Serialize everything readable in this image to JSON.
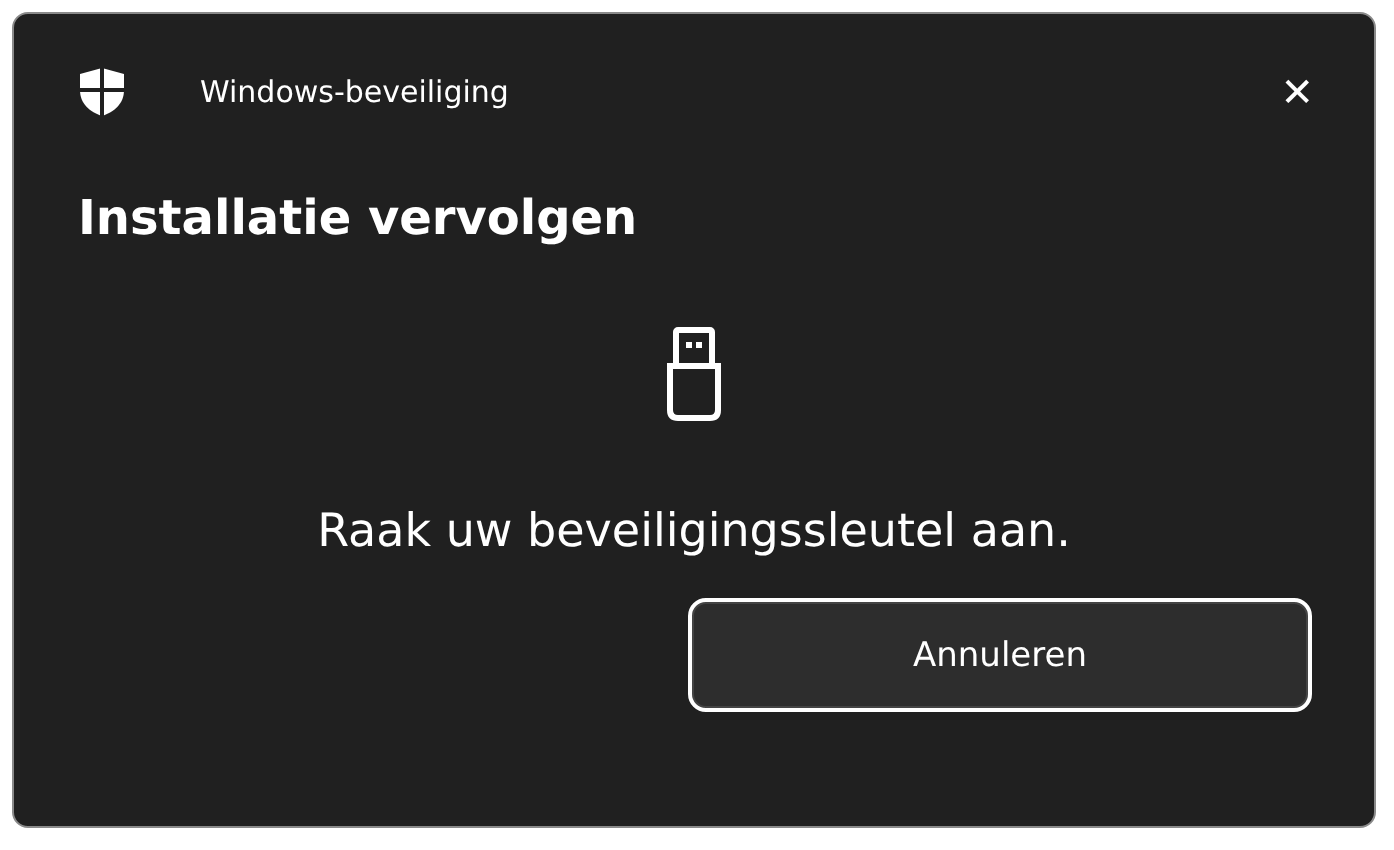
{
  "window": {
    "title": "Windows-beveiliging",
    "close": "✕"
  },
  "heading": "Installatie vervolgen",
  "message": "Raak uw beveiligingssleutel aan.",
  "buttons": [
    {
      "label": "Annuleren",
      "focused": true
    }
  ]
}
